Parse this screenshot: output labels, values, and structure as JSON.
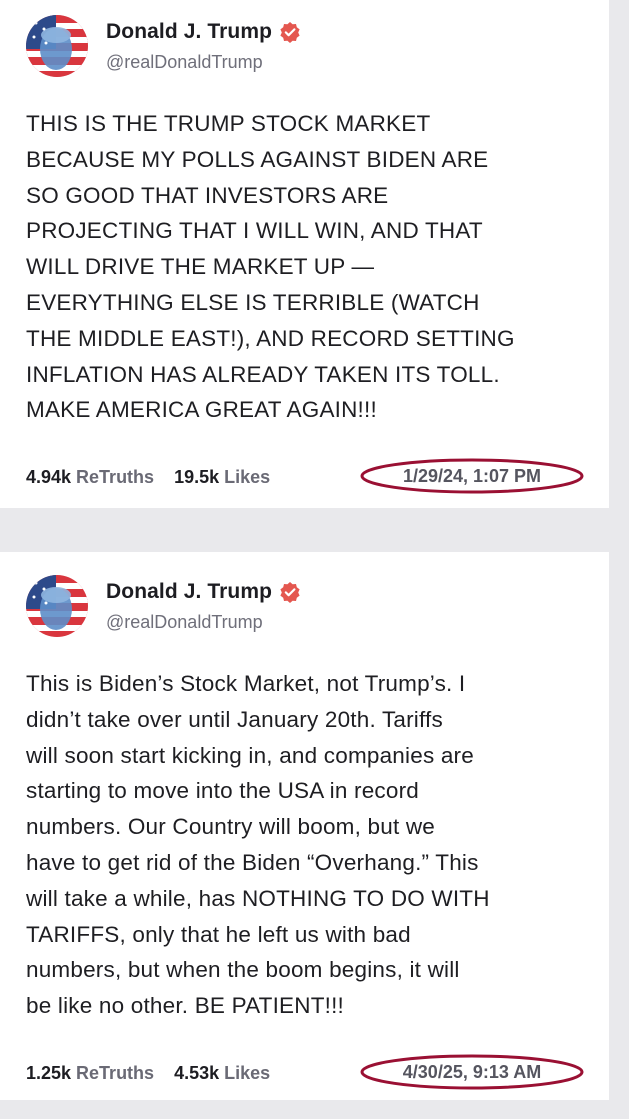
{
  "posts": [
    {
      "author": {
        "display_name": "Donald J. Trump",
        "handle": "@realDonaldTrump",
        "verified_icon": "verified-badge-icon"
      },
      "text": "THIS IS THE TRUMP STOCK MARKET\nBECAUSE MY POLLS AGAINST BIDEN ARE\nSO GOOD THAT INVESTORS ARE\nPROJECTING THAT I WILL WIN, AND THAT\nWILL DRIVE THE MARKET UP —\nEVERYTHING ELSE IS TERRIBLE (WATCH\nTHE MIDDLE EAST!), AND RECORD SETTING\nINFLATION HAS ALREADY TAKEN ITS TOLL.\nMAKE AMERICA GREAT AGAIN!!!",
      "retruths_count": "4.94k",
      "retruths_label": "ReTruths",
      "likes_count": "19.5k",
      "likes_label": "Likes",
      "timestamp": "1/29/24, 1:07 PM"
    },
    {
      "author": {
        "display_name": "Donald J. Trump",
        "handle": "@realDonaldTrump",
        "verified_icon": "verified-badge-icon"
      },
      "text": "This is Biden’s Stock Market, not Trump’s. I\ndidn’t take over until January 20th. Tariffs\nwill soon start kicking in, and companies are\nstarting to move into the USA in record\nnumbers. Our Country will boom, but we\nhave to get rid of the Biden “Overhang.” This\nwill take a while, has NOTHING TO DO WITH\nTARIFFS, only that he left us with bad\nnumbers, but when the boom begins, it will\nbe like no other. BE PATIENT!!!",
      "retruths_count": "1.25k",
      "retruths_label": "ReTruths",
      "likes_count": "4.53k",
      "likes_label": "Likes",
      "timestamp": "4/30/25, 9:13 AM"
    }
  ],
  "colors": {
    "verified": "#e4574f",
    "highlight_ellipse": "#9a1033",
    "background": "#e9e9ec"
  }
}
